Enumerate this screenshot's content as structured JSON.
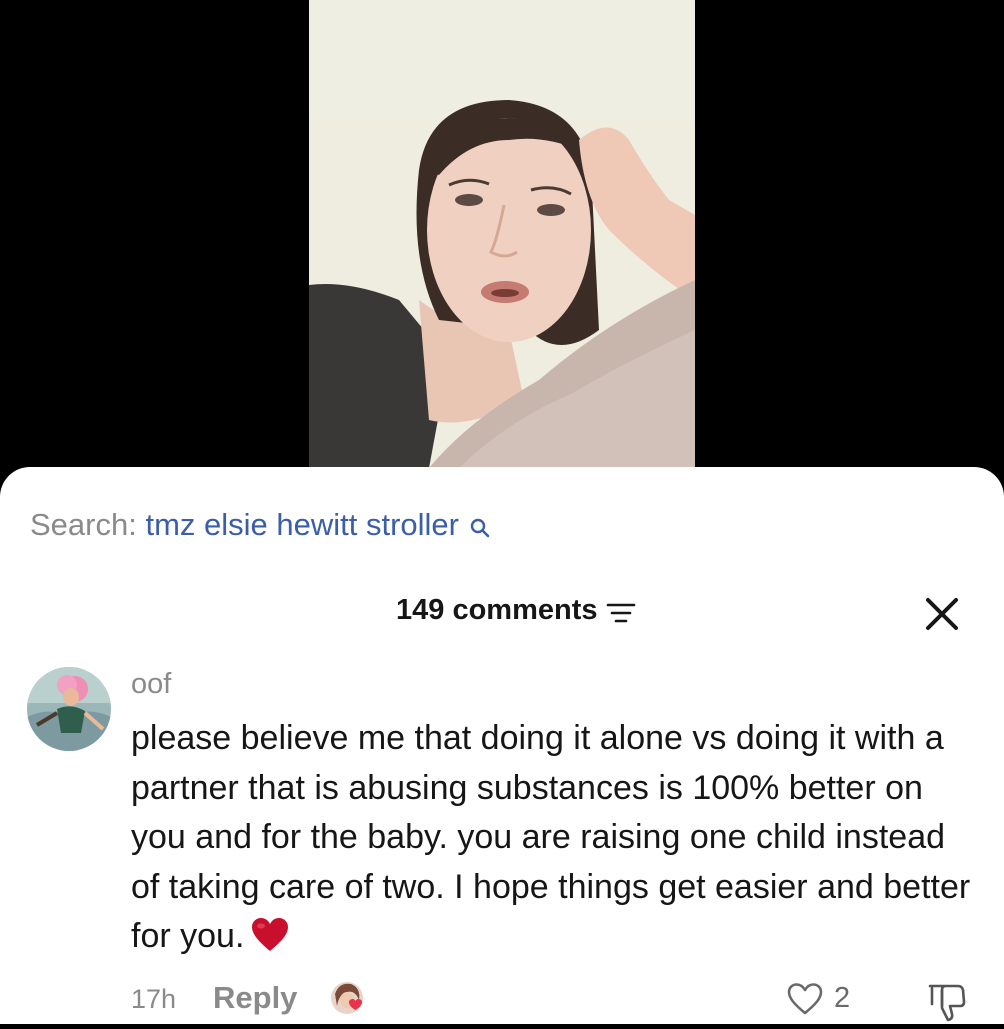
{
  "search": {
    "prefix": "Search:",
    "query": "tmz elsie hewitt stroller"
  },
  "comments_header": {
    "count_label": "149 comments"
  },
  "comment": {
    "username": "oof",
    "text": "please believe me that doing it alone vs doing it with a partner that is abusing substances is 100% better on you and for the baby. you are raising one child instead of taking care of two. I hope things get easier and better for you.",
    "emoji": "red-heart",
    "timestamp": "17h",
    "reply_label": "Reply",
    "like_count": "2"
  },
  "icons": {
    "search": "search-icon",
    "filter": "filter-icon",
    "close": "close-icon",
    "like": "heart-outline-icon",
    "dislike": "thumbs-down-icon"
  },
  "colors": {
    "accent_link": "#3b5ea8",
    "muted_text": "#8a8a8a",
    "heart_emoji": "#c8102e"
  }
}
